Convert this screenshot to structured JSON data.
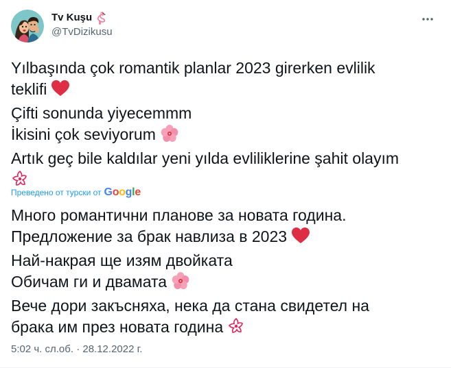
{
  "author": {
    "display_name": "Tv Kuşu",
    "handle": "@TvDizikusu",
    "avatar_icon": "avatar-illustration",
    "badge_icon": "flamingo-icon"
  },
  "more_icon": "more-horizontal-icon",
  "original_text": {
    "line1": "Yılbaşında çok romantik planlar 2023 girerken evlilik",
    "line2": "teklifi",
    "line3": "Çifti sonunda yiyecemmm",
    "line4": "İkisini çok seviyorum",
    "line5": "Artık geç bile kaldılar yeni yılda evliliklerine şahit olayım"
  },
  "translation_notice": {
    "label": "Преведено от турски от",
    "provider": {
      "g1": "G",
      "g2": "o",
      "g3": "o",
      "g4": "g",
      "g5": "l",
      "g6": "e"
    }
  },
  "translated_text": {
    "line1": "Много романтични планове за новата година.",
    "line2": "Предложение за брак навлиза в 2023",
    "line3": "Най-накрая ще изям двойката",
    "line4": "Обичам ги и двамата",
    "line5": "Вече дори закъсняха, нека да стана свидетел на",
    "line6": "брака им през новата година"
  },
  "timestamp": "5:02 ч. сл.об. · 28.12.2022 г.",
  "colors": {
    "text": "#0f1419",
    "secondary": "#536471",
    "link": "#1d9bf0",
    "heart": "#e0245e"
  }
}
